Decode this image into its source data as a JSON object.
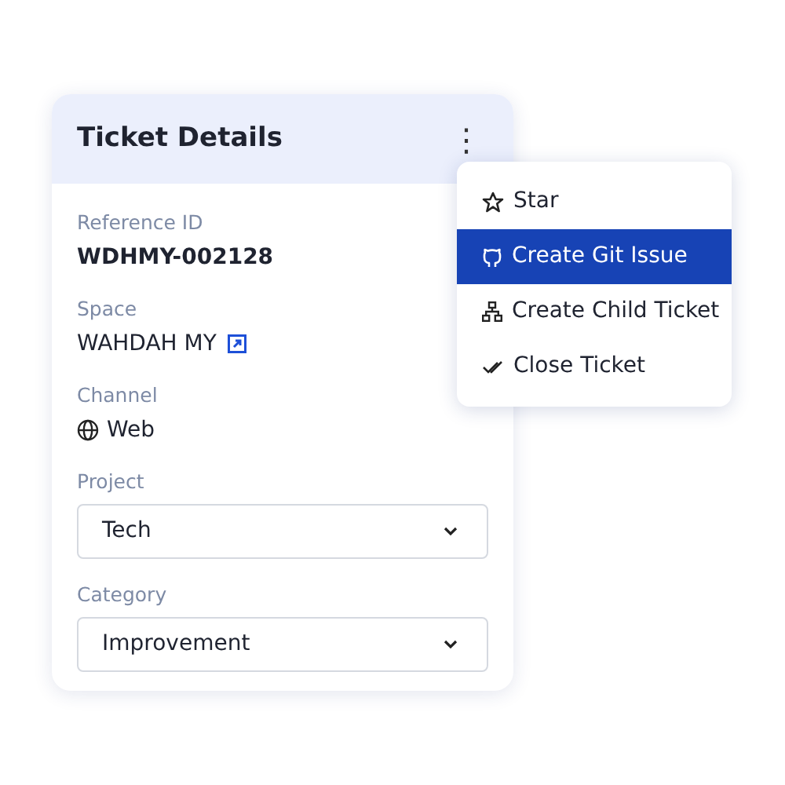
{
  "card": {
    "title": "Ticket Details",
    "more_button": "⋮",
    "fields": [
      {
        "label": "Reference ID",
        "kind": "bold",
        "value": "WDHMY-002128"
      },
      {
        "label": "Space",
        "kind": "link",
        "value": "WAHDAH MY"
      },
      {
        "label": "Channel",
        "kind": "globe",
        "value": "Web"
      },
      {
        "label": "Project",
        "kind": "select",
        "value": "Tech"
      },
      {
        "label": "Category",
        "kind": "select",
        "value": "Improvement"
      }
    ]
  },
  "menu": {
    "items": [
      {
        "kind": "star",
        "label": "Star",
        "selected": false
      },
      {
        "kind": "git",
        "label": "Create Git Issue",
        "selected": true
      },
      {
        "kind": "hierarchy",
        "label": "Create Child Ticket",
        "selected": false
      },
      {
        "kind": "checks",
        "label": "Close Ticket",
        "selected": false
      }
    ]
  }
}
